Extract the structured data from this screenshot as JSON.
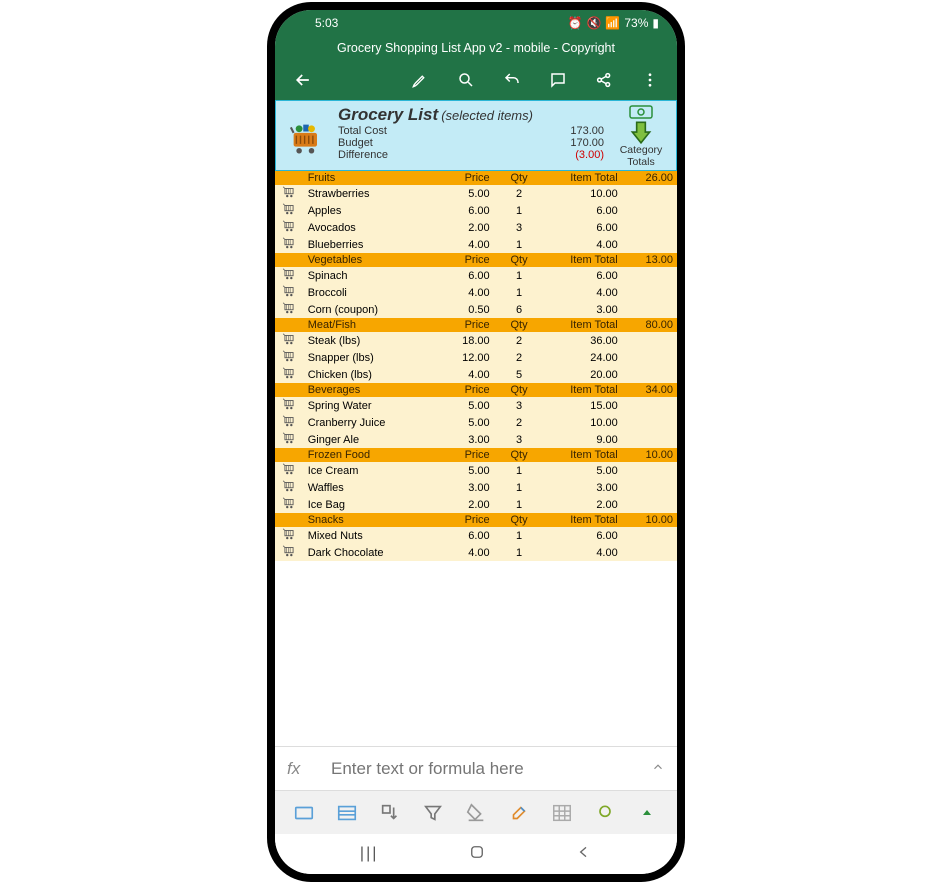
{
  "status": {
    "time": "5:03",
    "battery": "73%"
  },
  "app": {
    "title": "Grocery Shopping List App v2 - mobile - Copyright"
  },
  "header": {
    "title": "Grocery List",
    "subtitle": "(selected items)",
    "total_cost_label": "Total Cost",
    "total_cost": "173.00",
    "budget_label": "Budget",
    "budget": "170.00",
    "difference_label": "Difference",
    "difference": "(3.00)",
    "side_line1": "Category",
    "side_line2": "Totals"
  },
  "columns": {
    "price": "Price",
    "qty": "Qty",
    "item_total": "Item Total"
  },
  "categories": [
    {
      "name": "Fruits",
      "total": "26.00",
      "items": [
        {
          "name": "Strawberries",
          "price": "5.00",
          "qty": "2",
          "total": "10.00"
        },
        {
          "name": "Apples",
          "price": "6.00",
          "qty": "1",
          "total": "6.00"
        },
        {
          "name": "Avocados",
          "price": "2.00",
          "qty": "3",
          "total": "6.00"
        },
        {
          "name": "Blueberries",
          "price": "4.00",
          "qty": "1",
          "total": "4.00"
        }
      ]
    },
    {
      "name": "Vegetables",
      "total": "13.00",
      "items": [
        {
          "name": "Spinach",
          "price": "6.00",
          "qty": "1",
          "total": "6.00"
        },
        {
          "name": "Broccoli",
          "price": "4.00",
          "qty": "1",
          "total": "4.00"
        },
        {
          "name": "Corn (coupon)",
          "price": "0.50",
          "qty": "6",
          "total": "3.00"
        }
      ]
    },
    {
      "name": "Meat/Fish",
      "total": "80.00",
      "items": [
        {
          "name": "Steak (lbs)",
          "price": "18.00",
          "qty": "2",
          "total": "36.00"
        },
        {
          "name": "Snapper (lbs)",
          "price": "12.00",
          "qty": "2",
          "total": "24.00"
        },
        {
          "name": "Chicken (lbs)",
          "price": "4.00",
          "qty": "5",
          "total": "20.00"
        }
      ]
    },
    {
      "name": "Beverages",
      "total": "34.00",
      "items": [
        {
          "name": "Spring Water",
          "price": "5.00",
          "qty": "3",
          "total": "15.00"
        },
        {
          "name": "Cranberry Juice",
          "price": "5.00",
          "qty": "2",
          "total": "10.00"
        },
        {
          "name": "Ginger Ale",
          "price": "3.00",
          "qty": "3",
          "total": "9.00"
        }
      ]
    },
    {
      "name": "Frozen Food",
      "total": "10.00",
      "items": [
        {
          "name": "Ice Cream",
          "price": "5.00",
          "qty": "1",
          "total": "5.00"
        },
        {
          "name": "Waffles",
          "price": "3.00",
          "qty": "1",
          "total": "3.00"
        },
        {
          "name": "Ice Bag",
          "price": "2.00",
          "qty": "1",
          "total": "2.00"
        }
      ]
    },
    {
      "name": "Snacks",
      "total": "10.00",
      "items": [
        {
          "name": "Mixed Nuts",
          "price": "6.00",
          "qty": "1",
          "total": "6.00"
        },
        {
          "name": "Dark Chocolate",
          "price": "4.00",
          "qty": "1",
          "total": "4.00"
        }
      ]
    }
  ],
  "formula_bar": {
    "fx": "fx",
    "placeholder": "Enter text or formula here"
  }
}
